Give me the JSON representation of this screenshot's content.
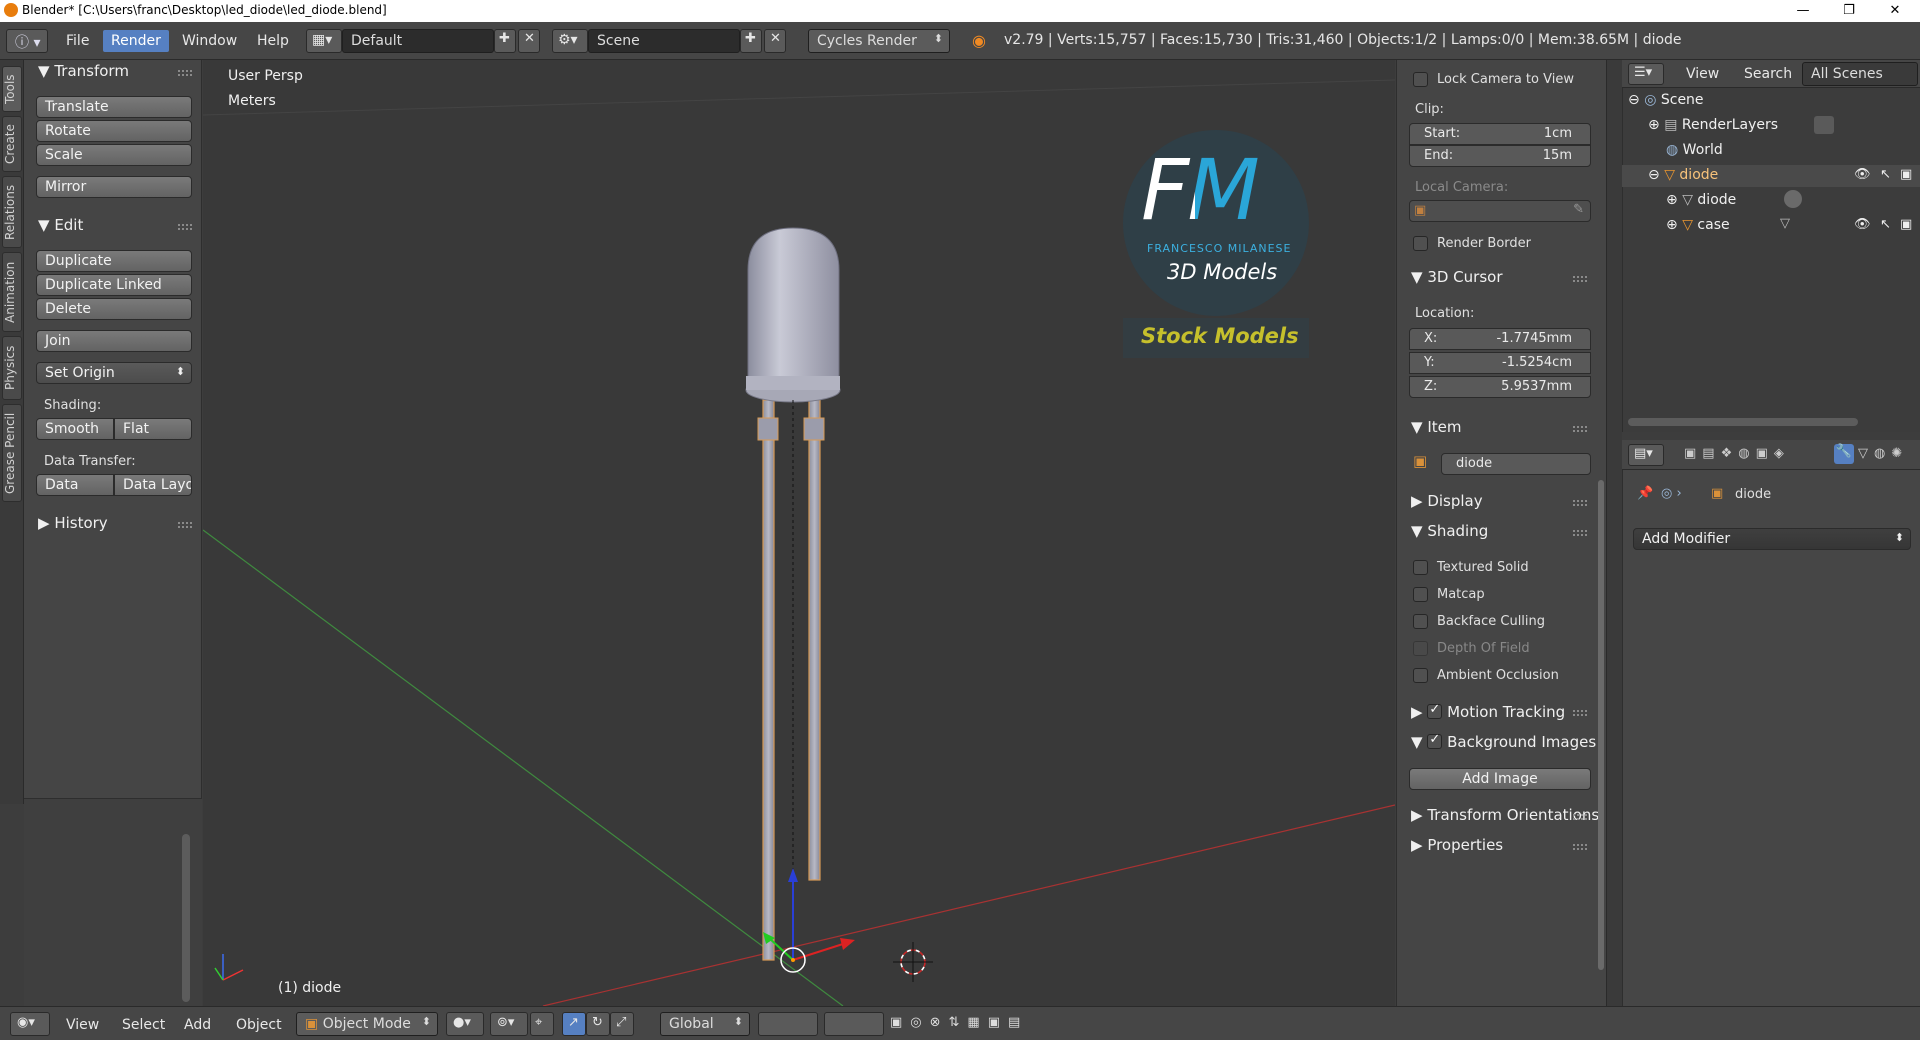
{
  "window": {
    "title": "Blender* [C:\\Users\\franc\\Desktop\\led_diode\\led_diode.blend]",
    "minimize": "—",
    "maximize": "❐",
    "close": "✕"
  },
  "header": {
    "menus": [
      "File",
      "Render",
      "Window",
      "Help"
    ],
    "layout": "Default",
    "scene": "Scene",
    "engine": "Cycles Render",
    "stats": "v2.79 | Verts:15,757 | Faces:15,730 | Tris:31,460 | Objects:1/2 | Lamps:0/0 | Mem:38.65M | diode"
  },
  "toolshelf": {
    "tabs": [
      "Tools",
      "Create",
      "Relations",
      "Animation",
      "Physics",
      "Grease Pencil"
    ],
    "transform": {
      "title": "Transform",
      "buttons": [
        "Translate",
        "Rotate",
        "Scale",
        "Mirror"
      ]
    },
    "edit": {
      "title": "Edit",
      "buttons": [
        "Duplicate",
        "Duplicate Linked",
        "Delete",
        "Join"
      ],
      "set_origin": "Set Origin",
      "shading_label": "Shading:",
      "smooth": "Smooth",
      "flat": "Flat",
      "data_transfer_label": "Data Transfer:",
      "data": "Data",
      "data_layout": "Data Layo"
    },
    "history": "History"
  },
  "viewport": {
    "view_name": "User Persp",
    "units": "Meters",
    "object_label": "(1) diode",
    "watermark": {
      "logo": "FM",
      "author": "FRANCESCO MILANESE",
      "models": "3D Models",
      "stock": "Stock Models"
    }
  },
  "npanel": {
    "lock_camera": "Lock Camera to View",
    "clip_label": "Clip:",
    "start_label": "Start:",
    "start_value": "1cm",
    "end_label": "End:",
    "end_value": "15m",
    "local_camera": "Local Camera:",
    "render_border": "Render Border",
    "cursor_title": "3D Cursor",
    "location_label": "Location:",
    "x_label": "X:",
    "x_value": "-1.7745mm",
    "y_label": "Y:",
    "y_value": "-1.5254cm",
    "z_label": "Z:",
    "z_value": "5.9537mm",
    "item_title": "Item",
    "item_name": "diode",
    "display_title": "Display",
    "shading_title": "Shading",
    "shading_options": [
      {
        "label": "Textured Solid",
        "checked": false,
        "disabled": false
      },
      {
        "label": "Matcap",
        "checked": false,
        "disabled": false
      },
      {
        "label": "Backface Culling",
        "checked": false,
        "disabled": false
      },
      {
        "label": "Depth Of Field",
        "checked": false,
        "disabled": true
      },
      {
        "label": "Ambient Occlusion",
        "checked": false,
        "disabled": false
      }
    ],
    "motion_tracking": "Motion Tracking",
    "background_images": "Background Images",
    "add_image": "Add Image",
    "transform_orientations": "Transform Orientations",
    "properties": "Properties"
  },
  "outliner": {
    "view": "View",
    "search": "Search",
    "filter": "All Scenes",
    "rows": [
      "Scene",
      "RenderLayers",
      "World",
      "diode",
      "diode",
      "case"
    ]
  },
  "properties": {
    "context": "diode",
    "add_modifier": "Add Modifier"
  },
  "bottombar": {
    "menus": [
      "View",
      "Select",
      "Add",
      "Object"
    ],
    "mode": "Object Mode",
    "orientation": "Global"
  }
}
